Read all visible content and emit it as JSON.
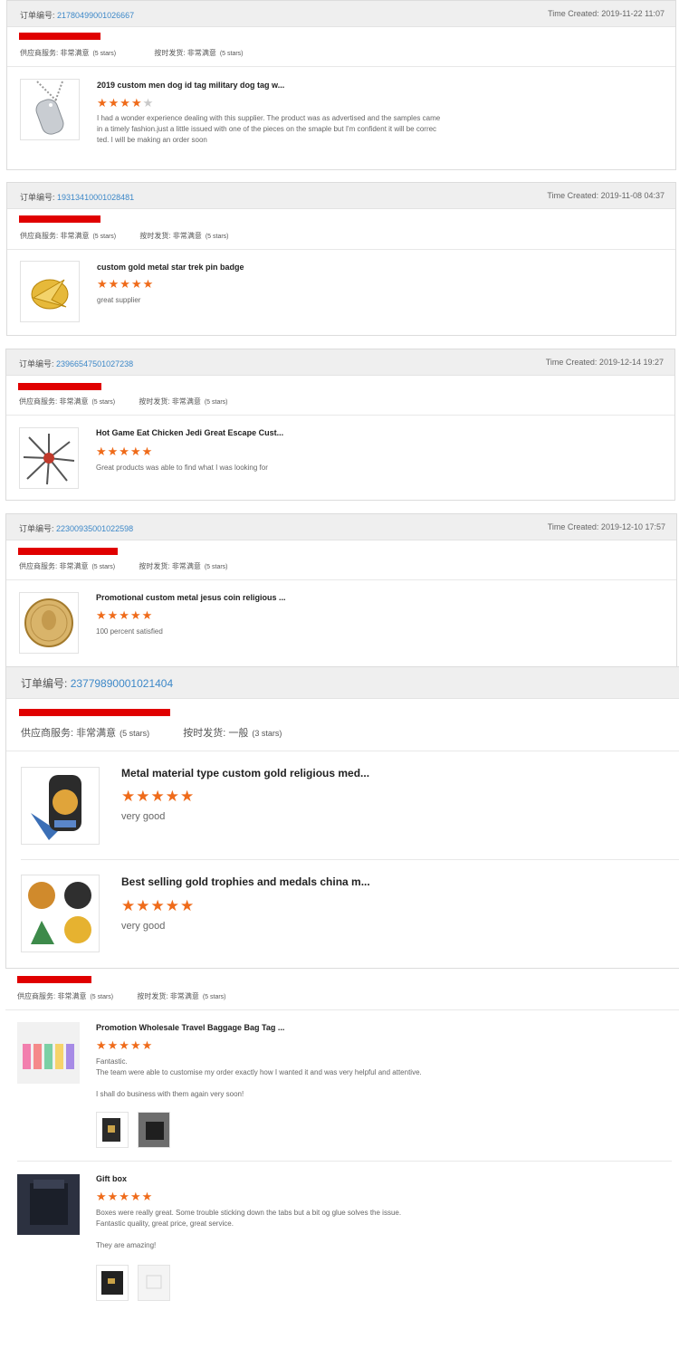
{
  "orders": [
    {
      "label": "订单编号:",
      "number": "21780499001026667",
      "time": "Time Created: 2019-11-22 11:07",
      "service_label": "供应商服务:",
      "service_value": "非常满意",
      "service_stars": "(5 stars)",
      "ship_label": "按时发货:",
      "ship_value": "非常满意",
      "ship_stars": "(5 stars)",
      "products": [
        {
          "title": "2019 custom men dog id tag military dog tag w...",
          "rating": 4,
          "review_lines": [
            "I had a wonder experience dealing with this supplier. The product was as advertised and the samples came",
            "in a timely fashion.just a little issued with one of the pieces on the smaple but I'm confident it will be correc",
            "ted. I will be making an order soon"
          ],
          "thumb_icon": "dog-tag-icon"
        }
      ]
    },
    {
      "label": "订单编号:",
      "number": "19313410001028481",
      "time": "Time Created: 2019-11-08 04:37",
      "service_label": "供应商服务:",
      "service_value": "非常满意",
      "service_stars": "(5 stars)",
      "ship_label": "按时发货:",
      "ship_value": "非常满意",
      "ship_stars": "(5 stars)",
      "products": [
        {
          "title": "custom gold metal star trek pin badge",
          "rating": 5,
          "review_lines": [
            "great supplier"
          ],
          "thumb_icon": "gold-badge-icon"
        }
      ]
    },
    {
      "label": "订单编号:",
      "number": "23966547501027238",
      "time": "Time Created: 2019-12-14 19:27",
      "service_label": "供应商服务:",
      "service_value": "非常满意",
      "service_stars": "(5 stars)",
      "ship_label": "按时发货:",
      "ship_value": "非常满意",
      "ship_stars": "(5 stars)",
      "products": [
        {
          "title": "Hot Game Eat Chicken Jedi Great Escape Cust...",
          "rating": 5,
          "review_lines": [
            "Great products was able to find what I was looking for"
          ],
          "thumb_icon": "keychain-set-icon"
        }
      ]
    },
    {
      "label": "订单编号:",
      "number": "22300935001022598",
      "time": "Time Created: 2019-12-10 17:57",
      "service_label": "供应商服务:",
      "service_value": "非常满意",
      "service_stars": "(5 stars)",
      "ship_label": "按时发货:",
      "ship_value": "非常满意",
      "ship_stars": "(5 stars)",
      "products": [
        {
          "title": "Promotional custom metal jesus coin religious ...",
          "rating": 5,
          "review_lines": [
            "100 percent satisfied"
          ],
          "thumb_icon": "gold-coin-icon"
        }
      ]
    },
    {
      "label": "订单编号:",
      "number": "23779890001021404",
      "time": "",
      "service_label": "供应商服务:",
      "service_value": "非常满意",
      "service_stars": "(5 stars)",
      "ship_label": "按时发货:",
      "ship_value": "一般",
      "ship_stars": "(3 stars)",
      "products": [
        {
          "title": "Metal material type custom gold religious med...",
          "rating": 5,
          "review_lines": [
            "very good"
          ],
          "thumb_icon": "medal-icon"
        },
        {
          "title": "Best selling gold trophies and medals china m...",
          "rating": 5,
          "review_lines": [
            "very good"
          ],
          "thumb_icon": "medals-set-icon"
        }
      ]
    },
    {
      "label": "",
      "number": "",
      "time": "",
      "service_label": "供应商服务:",
      "service_value": "非常满意",
      "service_stars": "(5 stars)",
      "ship_label": "按时发货:",
      "ship_value": "非常满意",
      "ship_stars": "(5 stars)",
      "products": [
        {
          "title": "Promotion Wholesale Travel Baggage Bag Tag ...",
          "rating": 5,
          "review_lines": [
            "Fantastic.",
            "The team were able to customise my order exactly how I wanted it and was very helpful and attentive.",
            "",
            "I shall do business with them again very soon!"
          ],
          "thumb_icon": "luggage-tags-icon",
          "photos": [
            "photo-1",
            "photo-2"
          ]
        },
        {
          "title": "Gift box",
          "rating": 5,
          "review_lines": [
            "Boxes were really great. Some trouble sticking down the tabs but a bit og glue solves the issue.",
            "Fantastic quality, great price, great service.",
            "",
            "They are amazing!"
          ],
          "thumb_icon": "gift-box-icon",
          "photos": [
            "photo-1",
            "photo-2"
          ]
        }
      ]
    }
  ],
  "colors": {
    "accent_star": "#ef6b1a",
    "order_link": "#3d88c8",
    "redaction": "#e00000"
  }
}
